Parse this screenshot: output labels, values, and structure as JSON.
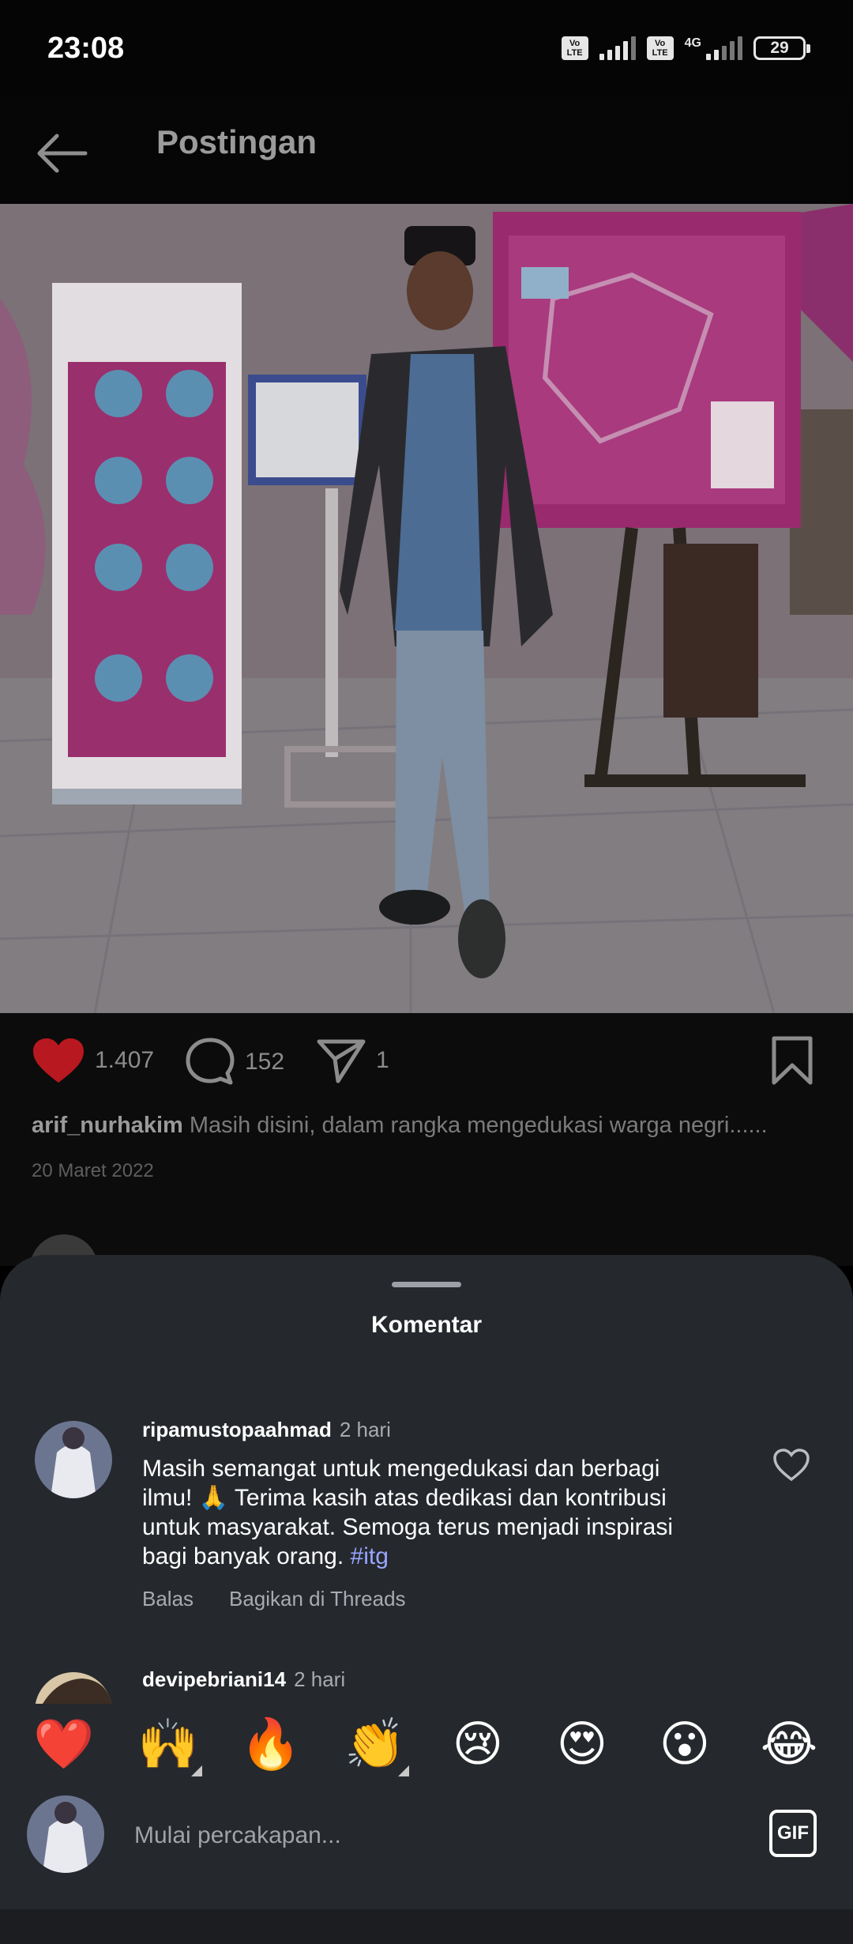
{
  "status_bar": {
    "time": "23:08",
    "volte_label": "Vo LTE",
    "network": "4G",
    "battery": "29"
  },
  "header": {
    "back_icon": "arrow-left-icon",
    "title": "Postingan"
  },
  "post": {
    "likes": "1.407",
    "comments": "152",
    "shares": "1",
    "author": "arif_nurhakim",
    "caption": "Masih disini, dalam rangka mengedukasi warga negri......",
    "date": "20 Maret 2022"
  },
  "comments_sheet": {
    "title": "Komentar",
    "items": [
      {
        "username": "ripamustopaahmad",
        "time": "2 hari",
        "text": "Masih semangat untuk mengedukasi dan berbagi ilmu! 🙏 Terima kasih atas dedikasi dan kontribusi untuk masyarakat. Semoga terus menjadi inspirasi bagi banyak orang.",
        "hashtag": "#itg",
        "reply_label": "Balas",
        "threads_label": "Bagikan di Threads"
      },
      {
        "username": "devipebriani14",
        "time": "2 hari"
      }
    ]
  },
  "reactions": [
    "❤️",
    "🙌",
    "🔥",
    "👏",
    "😢",
    "😍",
    "😮",
    "😂"
  ],
  "composer": {
    "placeholder": "Mulai percakapan...",
    "gif_label": "GIF"
  },
  "colors": {
    "sheet_bg": "#25282d",
    "like_red": "#b8181f",
    "hashtag": "#98a6ff"
  }
}
